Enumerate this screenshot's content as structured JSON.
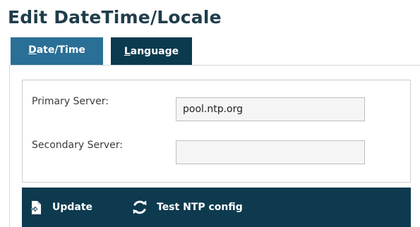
{
  "page": {
    "title": "Edit DateTime/Locale"
  },
  "tabs": [
    {
      "label": "Date/Time",
      "active": true
    },
    {
      "label": "Language",
      "active": false
    }
  ],
  "form": {
    "primary_label": "Primary Server:",
    "primary_value": "pool.ntp.org",
    "secondary_label": "Secondary Server:",
    "secondary_value": ""
  },
  "toolbar": {
    "update_label": "Update",
    "update_icon": "file-import-icon",
    "test_label": "Test NTP config",
    "test_icon": "refresh-icon"
  },
  "colors": {
    "title": "#1f3d4b",
    "tab_active": "#2a6f96",
    "tab_inactive": "#0b3a4e",
    "toolbar": "#0d3a4f"
  }
}
